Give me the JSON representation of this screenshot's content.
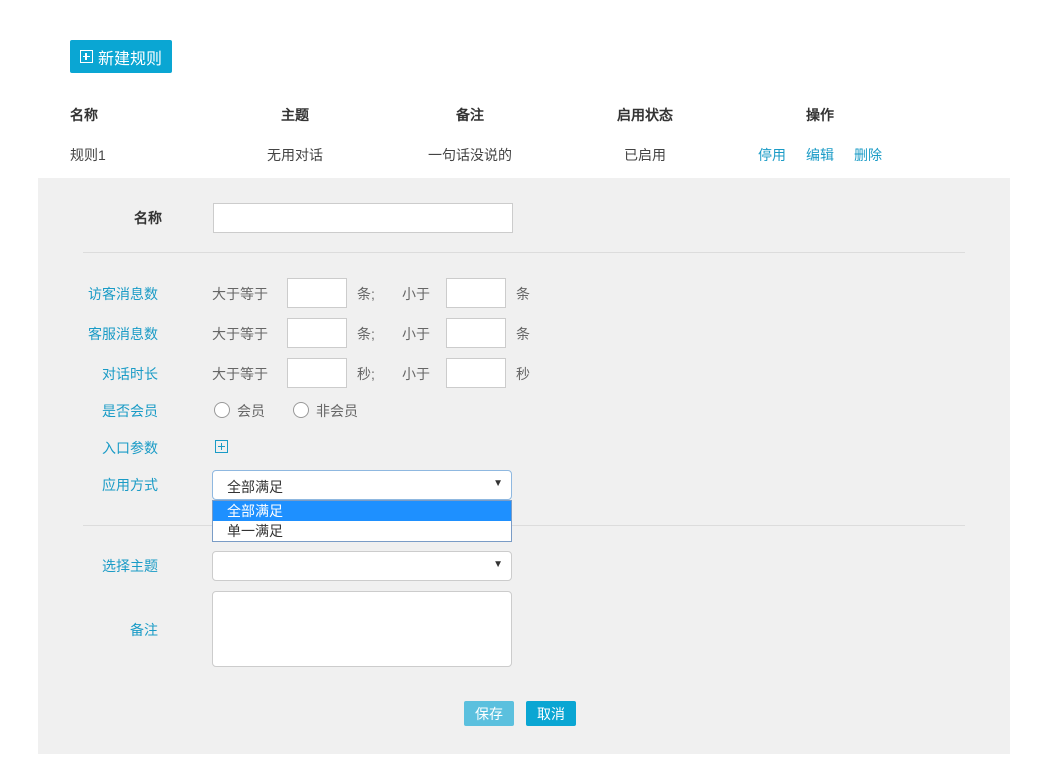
{
  "toolbar": {
    "new_rule_label": "新建规则"
  },
  "table": {
    "headers": [
      "名称",
      "主题",
      "备注",
      "启用状态",
      "操作"
    ],
    "rows": [
      {
        "name": "规则1",
        "topic": "无用对话",
        "remark": "一句话没说的",
        "status": "已启用",
        "actions": [
          "停用",
          "编辑",
          "删除"
        ]
      }
    ]
  },
  "form": {
    "name_label": "名称",
    "name_value": "",
    "visitor_msg_label": "访客消息数",
    "agent_msg_label": "客服消息数",
    "duration_label": "对话时长",
    "gte_text": "大于等于",
    "lt_text": "小于",
    "unit_msg_semicolon": "条;",
    "unit_msg": "条",
    "unit_sec_semicolon": "秒;",
    "unit_sec": "秒",
    "member_label": "是否会员",
    "member_options": [
      "会员",
      "非会员"
    ],
    "entry_param_label": "入口参数",
    "apply_mode_label": "应用方式",
    "apply_mode_value": "全部满足",
    "apply_mode_options": [
      "全部满足",
      "单一满足"
    ],
    "topic_label": "选择主题",
    "topic_value": "",
    "remark_label": "备注",
    "save_label": "保存",
    "cancel_label": "取消"
  },
  "colors": {
    "accent": "#0aa6d3",
    "link": "#1a9bc6",
    "panel_bg": "#f0f0f0",
    "save_bg": "#5bc0de",
    "option_selected": "#1e90ff"
  }
}
